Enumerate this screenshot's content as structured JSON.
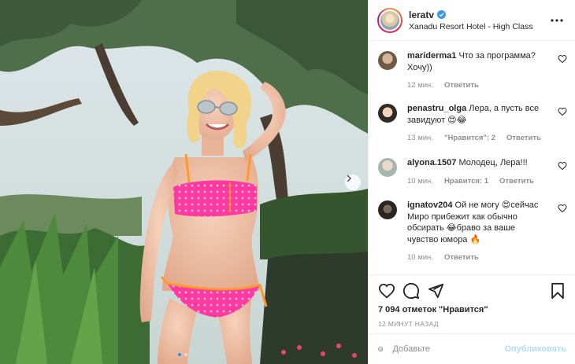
{
  "post": {
    "author": {
      "username": "leratv",
      "location": "Xanadu Resort Hotel - High Class",
      "verified": true
    },
    "media": {
      "description_icon": "photo",
      "carousel_count": 2,
      "carousel_index": 1,
      "next_icon": "chevron-right-icon"
    },
    "comments": [
      {
        "username": "mariderma1",
        "text": "Что за программа? Хочу))",
        "time": "12 мин.",
        "likes": "",
        "reply": "Ответить"
      },
      {
        "username": "penastru_olga",
        "text": "Лера, а пусть все завидуют 😍😂",
        "time": "13 мин.",
        "likes": "\"Нравится\": 2",
        "reply": "Ответить"
      },
      {
        "username": "alyona.1507",
        "text": "Молодец, Лера!!!",
        "time": "10 мин.",
        "likes": "Нравится: 1",
        "reply": "Ответить"
      },
      {
        "username": "ignatov204",
        "text": "Ой не могу 😍сейчас Миро прибежит как обычно обсирать 😂браво за ваше чувство юмора 🔥",
        "time": "10 мин.",
        "likes": "",
        "reply": "Ответить"
      }
    ],
    "likes_text": "7 094 отметок \"Нравится\"",
    "timestamp": "12 МИНУТ НАЗАД",
    "add_comment": {
      "placeholder": "Добавьте",
      "publish_label": "Опубликовать"
    },
    "colors": {
      "accent": "#0095f6",
      "publish_disabled": "#b3dbff",
      "meta_gray": "#8e8e8e",
      "bikini": "#ff3fa0"
    }
  }
}
